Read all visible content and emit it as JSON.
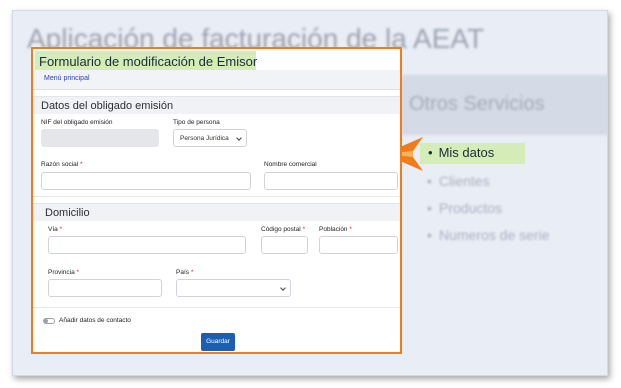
{
  "background_app": {
    "title": "Aplicación de facturación de la AEAT",
    "services_heading": "Otros Servicios",
    "menu_items": [
      "Clientes",
      "Productos",
      "Numeros de serie"
    ]
  },
  "callout": {
    "label": "Mis datos"
  },
  "form": {
    "title": "Formulario de modificación de Emisor",
    "menu_link": "Menú principal",
    "section_obligado": "Datos del obligado emisión",
    "nif_label": "NIF del obligado emisión",
    "tipo_persona_label": "Tipo de persona",
    "tipo_persona_value": "Persona Jurídica",
    "razon_social_label": "Razón social",
    "nombre_comercial_label": "Nombre comercial",
    "section_domicilio": "Domicilio",
    "via_label": "Vía",
    "codigo_postal_label": "Código postal",
    "poblacion_label": "Población",
    "provincia_label": "Provincia",
    "pais_label": "País",
    "contact_toggle_label": "Añadir datos de contacto",
    "save_button": "Guardar",
    "required_mark": "*"
  },
  "colors": {
    "frame_border": "#f07d1a",
    "highlight": "#d3ecb8",
    "primary_button": "#1a5fb4",
    "required": "#d92020"
  }
}
